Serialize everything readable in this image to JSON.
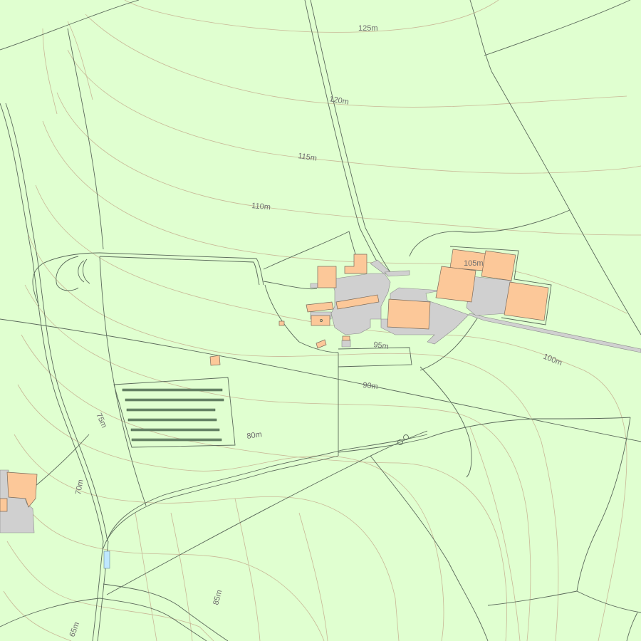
{
  "map": {
    "colors": {
      "land": "#e0ffd0",
      "building": "#fcc899",
      "paved_area": "#d0d0d0",
      "contour": "#c8b896",
      "boundary": "#5a6a5a",
      "water": "#bfe8ff"
    },
    "contour_labels": {
      "c125": "125m",
      "c120": "120m",
      "c115": "115m",
      "c110": "110m",
      "c105": "105m",
      "c100": "100m",
      "c95": "95m",
      "c90": "90m",
      "c85": "85m",
      "c80": "80m",
      "c75": "75m",
      "c70": "70m",
      "c65": "65m"
    }
  }
}
